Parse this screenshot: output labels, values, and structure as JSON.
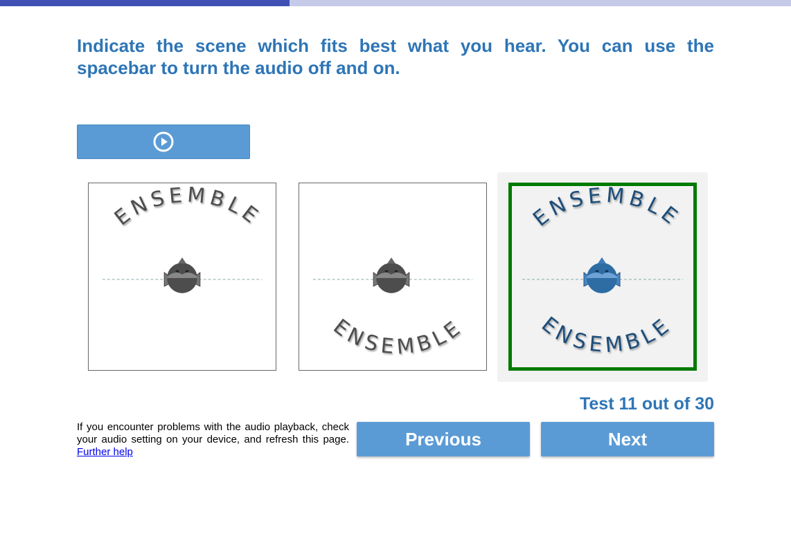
{
  "progress": {
    "fraction": 0.366
  },
  "instruction": "Indicate the scene which fits best what you hear. You can use the spacebar to turn the audio off and on.",
  "play_button": {
    "icon": "play-circle-icon"
  },
  "scenes": [
    {
      "word": "ENSEMBLE",
      "position": "front",
      "selected": false
    },
    {
      "word": "ENSEMBLE",
      "position": "back",
      "selected": false
    },
    {
      "word": "ENSEMBLE",
      "position": "front-and-back",
      "selected": true
    }
  ],
  "test_counter": "Test 11 out of 30",
  "help": {
    "text": "If you encounter problems with the audio playback, check your audio setting on your device, and refresh this page.",
    "link_label": "Further help"
  },
  "nav": {
    "previous_label": "Previous",
    "next_label": "Next"
  },
  "colors": {
    "accent": "#2e75b6",
    "button": "#5b9bd5",
    "progress_fill": "#3f51b5",
    "progress_track": "#c5cae9",
    "selected_border": "#007a00",
    "listener_gray": "#4d4d4d",
    "listener_blue": "#2e6da4"
  }
}
